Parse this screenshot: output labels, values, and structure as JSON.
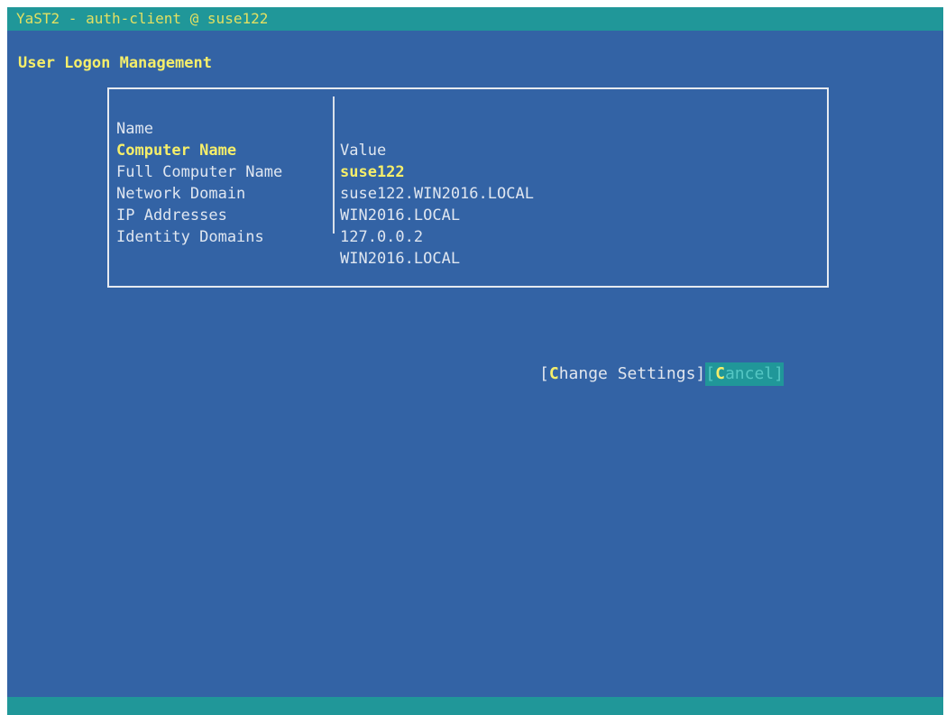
{
  "window": {
    "title": "YaST2 - auth-client @ suse122"
  },
  "page": {
    "heading": "User Logon Management"
  },
  "table": {
    "columns": [
      "Name",
      "Value"
    ],
    "rows": [
      {
        "name": "Computer Name",
        "value": "suse122",
        "selected": true
      },
      {
        "name": "Full Computer Name",
        "value": "suse122.WIN2016.LOCAL",
        "selected": false
      },
      {
        "name": "Network Domain",
        "value": "WIN2016.LOCAL",
        "selected": false
      },
      {
        "name": "IP Addresses",
        "value": "127.0.0.2",
        "selected": false
      },
      {
        "name": "Identity Domains",
        "value": "WIN2016.LOCAL",
        "selected": false
      }
    ]
  },
  "buttons": {
    "change_settings": {
      "open": "[",
      "hotkey": "C",
      "rest": "hange Settings",
      "close": "]"
    },
    "cancel": {
      "open": "[",
      "hotkey": "C",
      "rest": "ancel",
      "close": "]"
    }
  },
  "colors": {
    "background": "#3363a5",
    "bar": "#209799",
    "highlight": "#f5ee6a",
    "text": "#dfe6f0"
  }
}
